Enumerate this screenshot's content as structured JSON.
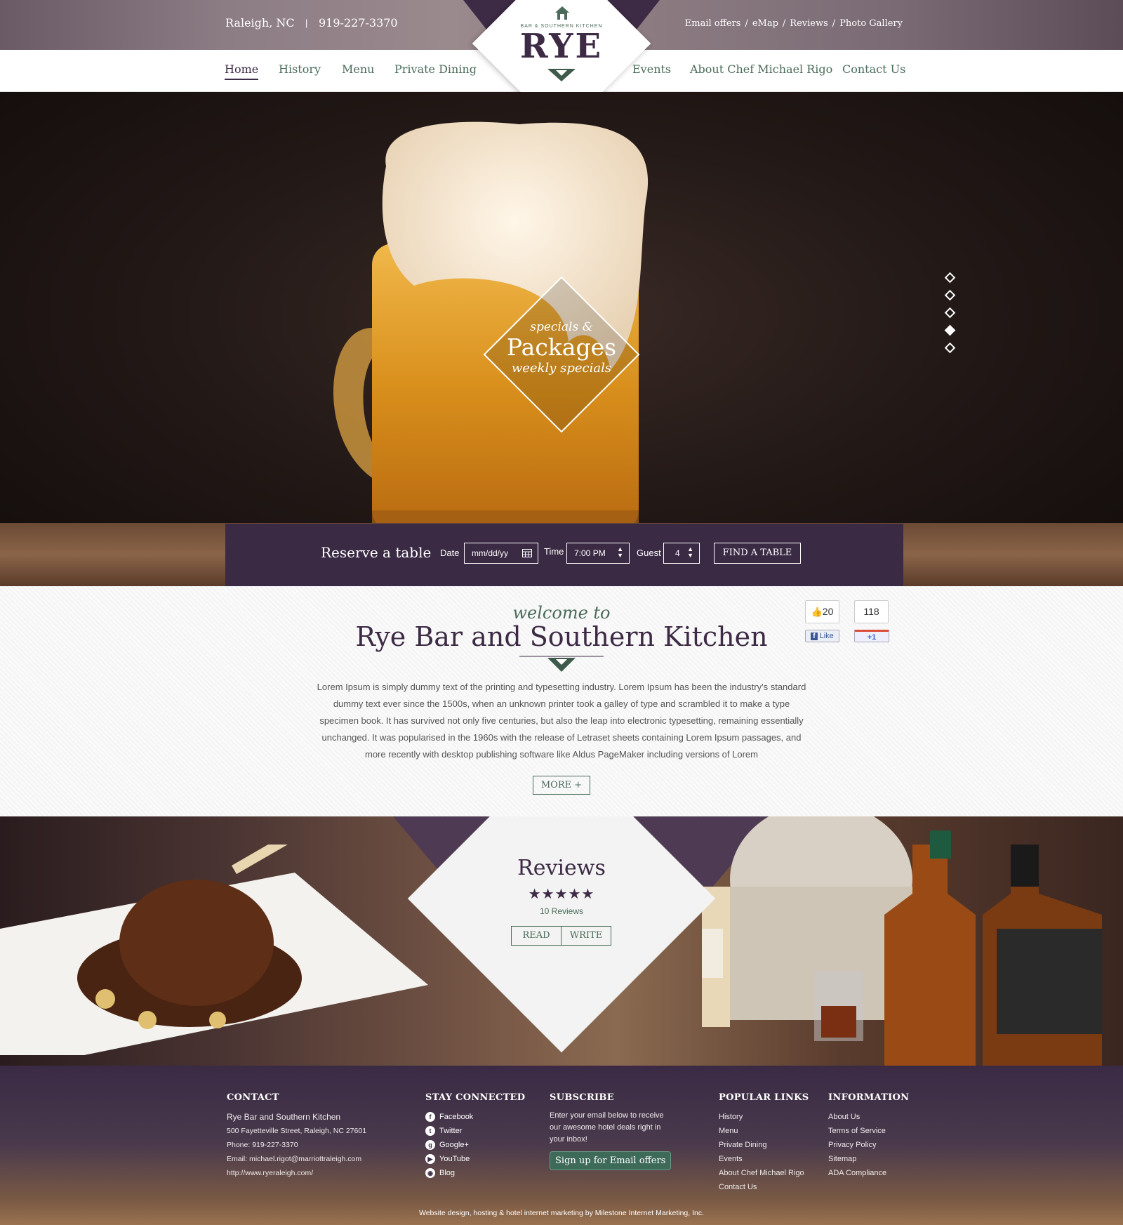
{
  "topbar": {
    "location": "Raleigh, NC",
    "separator": "|",
    "phone": "919-227-3370",
    "links": [
      "Email offers",
      "eMap",
      "Reviews",
      "Photo Gallery"
    ],
    "link_sep": "/"
  },
  "logo": {
    "subtitle": "BAR & SOUTHERN KITCHEN",
    "name": "RYE"
  },
  "nav": {
    "left": [
      "Home",
      "History",
      "Menu",
      "Private Dining"
    ],
    "right": [
      "Events",
      "About Chef Michael Rigo",
      "Contact Us"
    ],
    "active": "Home"
  },
  "hero": {
    "badge_line1": "specials &",
    "badge_line2": "Packages",
    "badge_line3": "weekly specials",
    "slides": 5,
    "active_slide": 4
  },
  "reserve": {
    "title": "Reserve a table",
    "date_label": "Date",
    "date_placeholder": "mm/dd/yy",
    "time_label": "Time",
    "time_value": "7:00 PM",
    "guest_label": "Guest",
    "guest_value": "4",
    "button": "FIND A TABLE"
  },
  "welcome": {
    "subtitle": "welcome to",
    "title": "Rye Bar and Southern Kitchen",
    "body": "Lorem Ipsum is simply dummy text of the printing and typesetting industry. Lorem Ipsum has been the industry's standard dummy text ever since the 1500s, when an unknown printer took a galley of type and scrambled it to make a type specimen book. It has survived not only five centuries, but also the leap into electronic typesetting, remaining essentially unchanged. It was popularised in the 1960s with the release of Letraset sheets containing Lorem Ipsum passages, and more recently with desktop publishing software like Aldus PageMaker including versions of Lorem",
    "more": "MORE +",
    "fb_count": "20",
    "fb_label": "Like",
    "gplus_count": "118",
    "gplus_label": "+1"
  },
  "reviews": {
    "title": "Reviews",
    "stars": "★★★★★",
    "rating": 5,
    "count": "10 Reviews",
    "read": "READ",
    "write": "WRITE"
  },
  "footer": {
    "contact": {
      "heading": "CONTACT",
      "name": "Rye Bar and Southern Kitchen",
      "address": "500 Fayetteville Street, Raleigh, NC 27601",
      "phone": "Phone: 919-227-3370",
      "email": "Email: michael.rigot@marriottraleigh.com",
      "url": "http://www.ryeraleigh.com/"
    },
    "stay_connected": {
      "heading": "STAY CONNECTED",
      "items": [
        "Facebook",
        "Twitter",
        "Google+",
        "YouTube",
        "Blog"
      ]
    },
    "subscribe": {
      "heading": "SUBSCRIBE",
      "text": "Enter your email below to receive our awesome hotel deals right in your inbox!",
      "button": "Sign up for Email offers"
    },
    "popular": {
      "heading": "POPULAR LINKS",
      "items": [
        "History",
        "Menu",
        "Private Dining",
        "Events",
        "About Chef Michael Rigo",
        "Contact Us"
      ]
    },
    "information": {
      "heading": "INFORMATION",
      "items": [
        "About Us",
        "Terms of Service",
        "Privacy Policy",
        "Sitemap",
        "ADA Compliance"
      ]
    },
    "credit": "Website design, hosting & hotel internet marketing by Milestone Internet Marketing, Inc."
  },
  "colors": {
    "brand_purple": "#3d2a45",
    "brand_green": "#4a6b5a"
  }
}
